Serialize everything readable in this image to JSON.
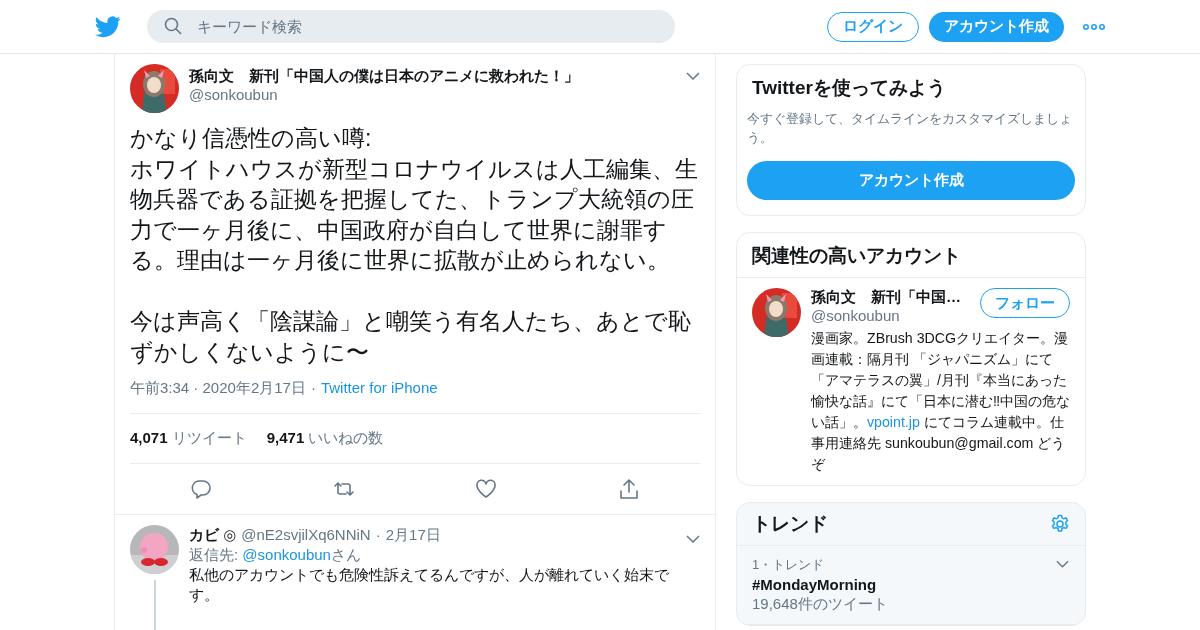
{
  "header": {
    "search": {
      "placeholder": "キーワード検索"
    },
    "login": "ログイン",
    "signup": "アカウント作成"
  },
  "tweet": {
    "name": "孫向文　新刊「中国人の僕は日本のアニメに救われた！」",
    "handle": "@sonkoubun",
    "paragraphs": [
      [
        "かなり信憑性の高い噂:",
        "ホワイトハウスが新型コロナウイルスは人工編集、生物兵器である証拠を把握してた、トランプ大統領の圧力で一ヶ月後に、中国政府が自白して世界に謝罪する。理由は一ヶ月後に世界に拡散が止められない。"
      ],
      [
        "今は声高く「陰謀論」と嘲笑う有名人たち、あとで恥ずかしくないように〜"
      ]
    ],
    "time": "午前3:34 · 2020年2月17日",
    "separator": "·",
    "source": "Twitter for iPhone",
    "stats": [
      {
        "count": "4,071",
        "label": "リツイート"
      },
      {
        "count": "9,471",
        "label": "いいねの数"
      }
    ]
  },
  "reply": {
    "name": "カビ ◎",
    "handle": "@nE2svjilXq6NNiN",
    "separator": "·",
    "date": "2月17日",
    "reply_prefix": "返信先: ",
    "reply_to": "@sonkoubun",
    "reply_suffix": "さん",
    "paragraphs": [
      "私他のアカウントでも危険性訴えてるんですが、人が離れていく始末です。"
    ]
  },
  "signup_card": {
    "title": "Twitterを使ってみよう",
    "text": "今すぐ登録して、タイムラインをカスタマイズしましょう。",
    "button": "アカウント作成"
  },
  "related": {
    "title": "関連性の高いアカウント",
    "accounts": [
      {
        "name": "孫向文　新刊「中国…",
        "handle": "@sonkoubun",
        "follow": "フォロー",
        "bio_before": "漫画家。ZBrush 3DCGクリエイター。漫画連載：隔月刊 「ジャパニズム」にて「アマテラスの翼」/月刊『本当にあった愉快な話』にて「日本に潜む‼中国の危ない話」。",
        "bio_link": "vpoint.jp",
        "bio_after": " にてコラム連載中。仕事用連絡先 sunkoubun@gmail.com どうぞ"
      }
    ]
  },
  "trends": {
    "title": "トレンド",
    "items": [
      {
        "meta": "1・トレンド",
        "name": "#MondayMorning",
        "count": "19,648件のツイート"
      }
    ]
  }
}
